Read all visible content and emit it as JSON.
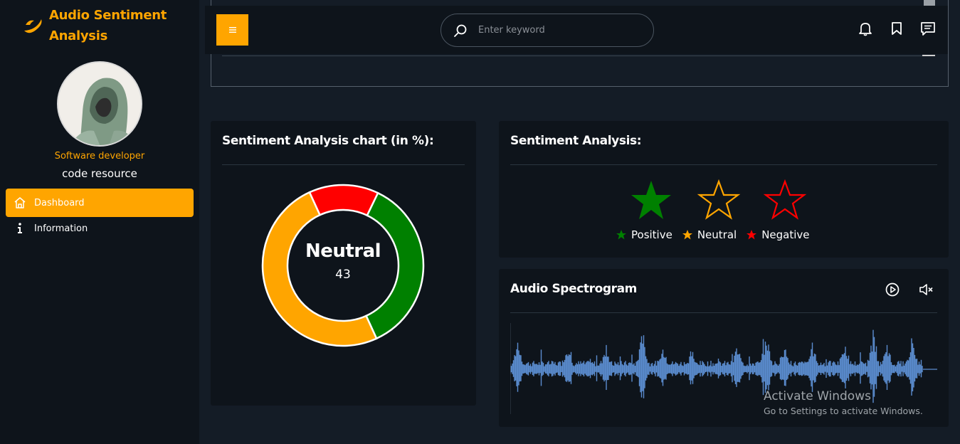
{
  "app": {
    "title": "Audio Sentiment Analysis"
  },
  "profile": {
    "role": "Software developer",
    "name": "code resource"
  },
  "sidebar": {
    "items": [
      {
        "label": "Dashboard",
        "icon": "home-icon",
        "active": true
      },
      {
        "label": "Information",
        "icon": "info-icon",
        "active": false
      }
    ]
  },
  "topbar": {
    "search_placeholder": "Enter keyword",
    "icons": [
      "bell-icon",
      "bookmark-icon",
      "message-icon"
    ]
  },
  "chart_card": {
    "title": "Sentiment Analysis chart (in %):",
    "center_label": "Neutral",
    "center_value": "43"
  },
  "chart_data": {
    "type": "pie",
    "categories": [
      "Negative",
      "Positive",
      "Neutral"
    ],
    "values": [
      14,
      36,
      50
    ],
    "colors": [
      "#ff0000",
      "#008000",
      "#ffa500"
    ],
    "title": "Sentiment Analysis chart (in %):"
  },
  "sentiment_card": {
    "title": "Sentiment Analysis:",
    "legend": [
      {
        "label": "Positive",
        "color": "#008000"
      },
      {
        "label": "Neutral",
        "color": "#ffa500"
      },
      {
        "label": "Negative",
        "color": "#ff0000"
      }
    ],
    "stars": [
      {
        "name": "positive-star-icon",
        "color": "#008000",
        "filled": true
      },
      {
        "name": "neutral-star-icon",
        "color": "#ffa500",
        "filled": false
      },
      {
        "name": "negative-star-icon",
        "color": "#ff0000",
        "filled": false
      }
    ]
  },
  "spectrogram_card": {
    "title": "Audio Spectrogram",
    "controls": [
      "play-icon",
      "mute-icon"
    ],
    "wave_color": "#5b8ccf"
  },
  "watermark": {
    "line1": "Activate Windows",
    "line2": "Go to Settings to activate Windows."
  },
  "theme": {
    "accent": "#ffa500",
    "panel": "#0e141b",
    "background": "#141c26"
  }
}
